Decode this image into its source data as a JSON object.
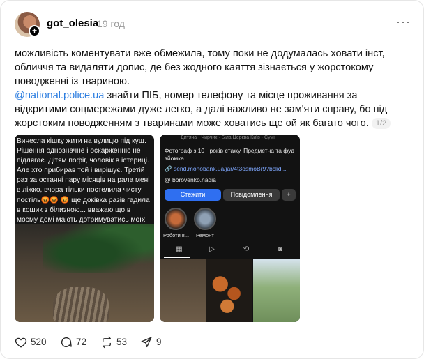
{
  "post": {
    "username": "got_olesia",
    "time": "19 год",
    "text_p1": "можливість коментувати вже обмежила, тому поки не додумалась ховати інст, обличчя та видаляти допис, де без жодного каяття зізнається у жорстокому поводженні із твариною.",
    "mention": "@national.police.ua",
    "text_p2": " знайти ПІБ, номер телефону та місце проживання за відкритими соцмережами дуже легко, а далі важливо не зам'яти справу, бо під жорстоким поводженням з тваринами може ховатись ще ой як багато чого.",
    "image_counter": "1/2"
  },
  "image1": {
    "caption": "Винесла кішку жити на вулицю під кущ. Рішення однозначне і оскарженню не підлягає. Дітям пофіг, чоловік в істериці. Але хто прибирав той і вирішує. Третій раз за останні пару місяців на рала мені в ліжко, вчора тільки постелила чисту постіль😡😡 😡 ще доківка разів гадила в кошик з білизною... вважаю що в моєму домі мають дотримуватись моїх правил а не срати мені на голову"
  },
  "image2": {
    "top_text": "Дитяча · Чирчик · Біла Церква Київ · Сумі",
    "bio": "Фотограф з 10+ років стажу. Предметна та фуд зйомка.",
    "link": "send.monobank.ua/jar/4t3osmoBr9?bclid...",
    "handle": "@ borovenko.nadia",
    "follow_label": "Стежити",
    "message_label": "Повідомлення",
    "add_label": "+",
    "highlight1": "Роботи в...",
    "highlight2": "Ремонт"
  },
  "actions": {
    "likes": "520",
    "comments": "72",
    "reposts": "53",
    "shares": "9"
  }
}
